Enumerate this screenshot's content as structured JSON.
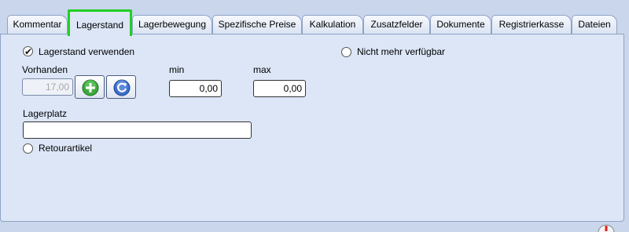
{
  "tabs": [
    {
      "label": "Kommentar"
    },
    {
      "label": "Lagerstand"
    },
    {
      "label": "Lagerbewegung"
    },
    {
      "label": "Spezifische Preise"
    },
    {
      "label": "Kalkulation"
    },
    {
      "label": "Zusatzfelder"
    },
    {
      "label": "Dokumente"
    },
    {
      "label": "Registrierkasse"
    },
    {
      "label": "Dateien"
    }
  ],
  "active_tab": "Lagerstand",
  "stock": {
    "use_stock_label": "Lagerstand verwenden",
    "use_stock_checked": true,
    "not_available_label": "Nicht mehr verfügbar",
    "not_available_checked": false,
    "available_label": "Vorhanden",
    "available_value": "17,00",
    "min_label": "min",
    "min_value": "0,00",
    "max_label": "max",
    "max_value": "0,00",
    "location_label": "Lagerplatz",
    "location_value": "",
    "return_item_label": "Retourartikel",
    "return_item_checked": false
  },
  "icons": {
    "add": "plus-icon",
    "refresh": "refresh-icon"
  },
  "colors": {
    "highlight": "#22d022",
    "panel": "#dce6f7",
    "background": "#c9d6ec"
  }
}
